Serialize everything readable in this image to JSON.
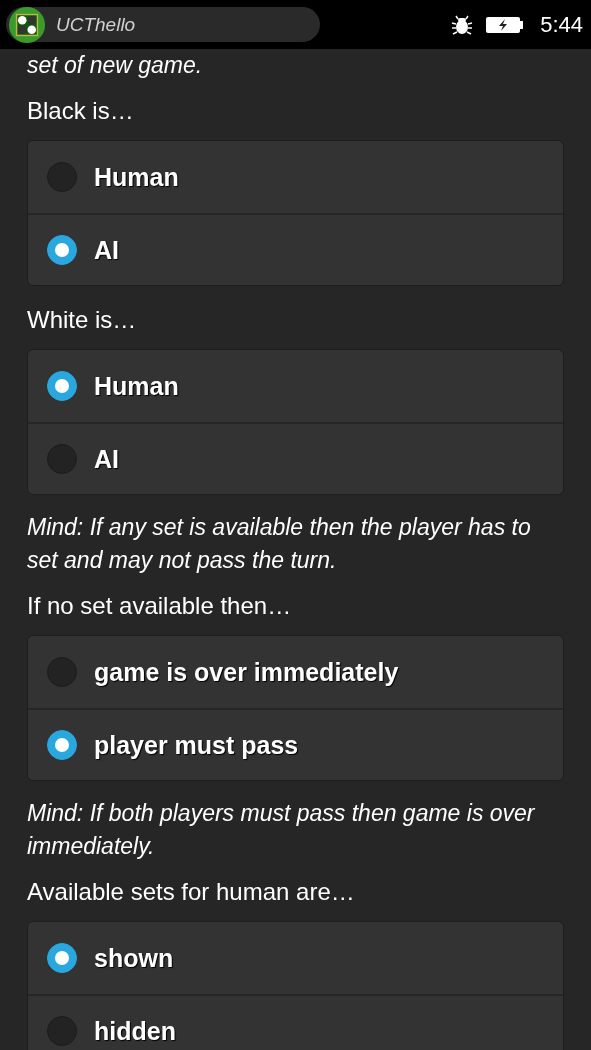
{
  "status_bar": {
    "app_title": "UCThello",
    "time": "5:44"
  },
  "blocks": [
    {
      "kind": "note",
      "text": "set of new game."
    },
    {
      "kind": "label",
      "text": "Black is…"
    },
    {
      "kind": "radio_group",
      "options": [
        {
          "label": "Human",
          "selected": false
        },
        {
          "label": "AI",
          "selected": true
        }
      ]
    },
    {
      "kind": "label",
      "text": "White is…"
    },
    {
      "kind": "radio_group",
      "options": [
        {
          "label": "Human",
          "selected": true
        },
        {
          "label": "AI",
          "selected": false
        }
      ]
    },
    {
      "kind": "note",
      "text": "Mind: If any set is available then the player has to set and may not pass the turn."
    },
    {
      "kind": "label",
      "text": "If no set available then…"
    },
    {
      "kind": "radio_group",
      "options": [
        {
          "label": "game is over immediately",
          "selected": false
        },
        {
          "label": "player must pass",
          "selected": true
        }
      ]
    },
    {
      "kind": "note",
      "text": "Mind: If both players must pass then game is over immediately."
    },
    {
      "kind": "label",
      "text": "Available sets for human are…"
    },
    {
      "kind": "radio_group",
      "options": [
        {
          "label": "shown",
          "selected": true
        },
        {
          "label": "hidden",
          "selected": false
        }
      ]
    }
  ]
}
